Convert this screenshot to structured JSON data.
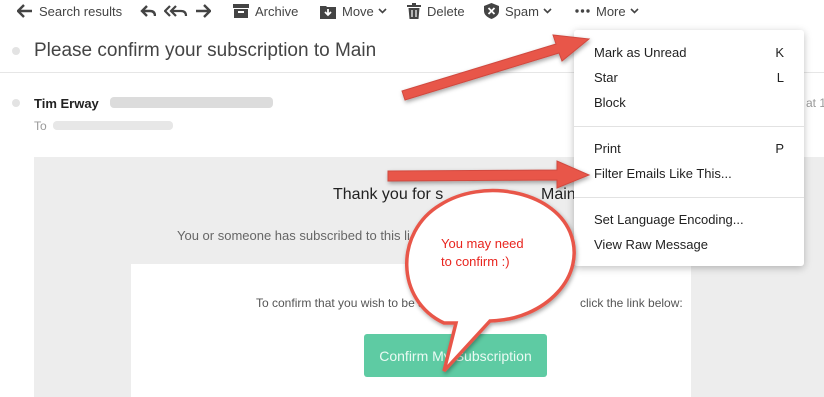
{
  "toolbar": {
    "back_label": "Search results",
    "archive_label": "Archive",
    "move_label": "Move",
    "delete_label": "Delete",
    "spam_label": "Spam",
    "more_label": "More"
  },
  "message": {
    "subject": "Please confirm your subscription to Main",
    "sender_name": "Tim Erway",
    "to_label": "To",
    "time_fragment": "at 1"
  },
  "email_body": {
    "thanks_start": "Thank you for s",
    "thanks_end": "Main",
    "subscribed_text": "You or someone has subscribed to this li",
    "confirm_start": "To confirm that you wish to be s",
    "confirm_end": "click the link below:",
    "button_label": "Confirm My Subscription"
  },
  "more_menu": {
    "items": [
      {
        "label": "Mark as Unread",
        "shortcut": "K"
      },
      {
        "label": "Star",
        "shortcut": "L"
      },
      {
        "label": "Block",
        "shortcut": ""
      },
      {
        "label": "Print",
        "shortcut": "P"
      },
      {
        "label": "Filter Emails Like This...",
        "shortcut": ""
      },
      {
        "label": "Set Language Encoding...",
        "shortcut": ""
      },
      {
        "label": "View Raw Message",
        "shortcut": ""
      }
    ]
  },
  "annotation": {
    "callout_line1": "You may need",
    "callout_line2": "to confirm :)"
  },
  "colors": {
    "button": "#5ecba3",
    "arrow": "#e8564a",
    "callout_text": "#e8251f",
    "panel": "#ededed"
  }
}
